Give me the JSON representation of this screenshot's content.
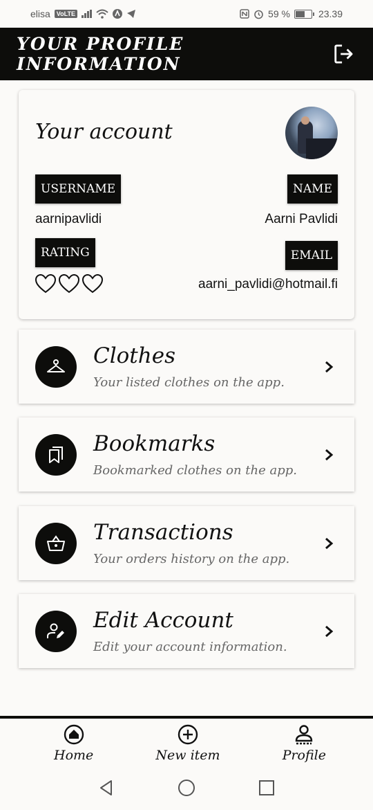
{
  "status_bar": {
    "carrier": "elisa",
    "volte": "VoLTE",
    "battery": "59 %",
    "battery_level": 0.59,
    "time": "23.39"
  },
  "header": {
    "title": "Your profile information",
    "logout_icon": "logout-icon"
  },
  "account": {
    "title": "Your account",
    "username_label": "USERNAME",
    "username": "aarnipavlidi",
    "name_label": "NAME",
    "name": "Aarni Pavlidi",
    "rating_label": "RATING",
    "rating": 0,
    "rating_max": 3,
    "email_label": "EMAIL",
    "email": "aarni_pavlidi@hotmail.fi"
  },
  "menu": [
    {
      "title": "Clothes",
      "subtitle": "Your listed clothes on the app.",
      "icon": "hanger-icon"
    },
    {
      "title": "Bookmarks",
      "subtitle": "Bookmarked clothes on the app.",
      "icon": "bookmarks-icon"
    },
    {
      "title": "Transactions",
      "subtitle": "Your orders history on the app.",
      "icon": "basket-icon"
    },
    {
      "title": "Edit Account",
      "subtitle": "Edit your account information.",
      "icon": "user-edit-icon"
    }
  ],
  "bottom_nav": {
    "home": "Home",
    "new_item": "New item",
    "profile": "Profile"
  },
  "colors": {
    "primary": "#0d0d0b",
    "background": "#fbfaf8",
    "subtitle": "#666666"
  }
}
